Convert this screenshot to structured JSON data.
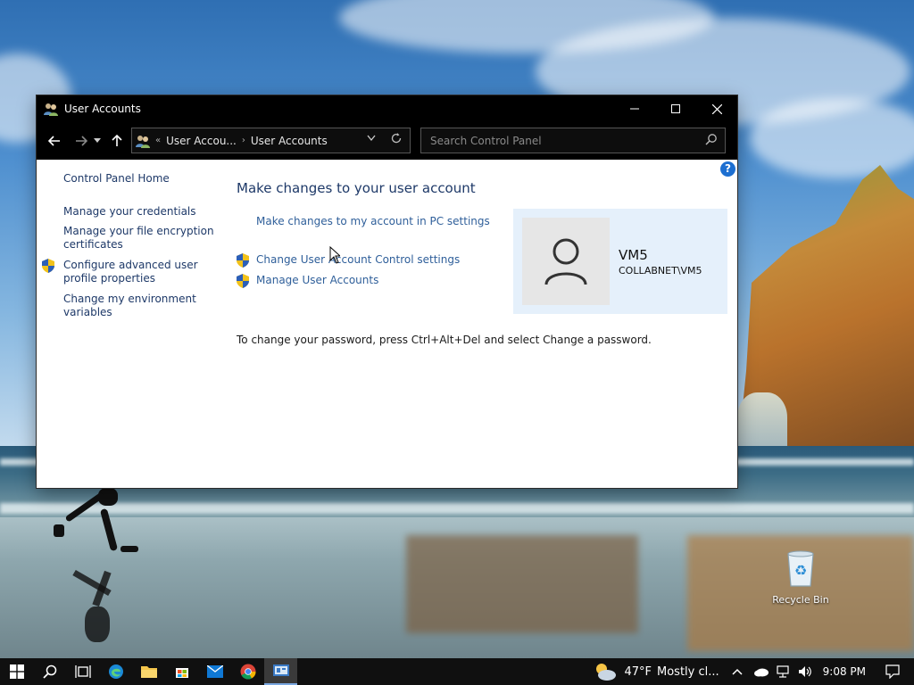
{
  "window": {
    "title": "User Accounts",
    "controls": {
      "minimize": "–",
      "maximize": "☐",
      "close": "✕"
    }
  },
  "navbar": {
    "breadcrumb": [
      "User Accou...",
      "User Accounts"
    ],
    "breadcrumb_prefix": "«",
    "search_placeholder": "Search Control Panel"
  },
  "sidebar": {
    "home": "Control Panel Home",
    "items": [
      "Manage your credentials",
      "Manage your file encryption certificates",
      "Configure advanced user profile properties",
      "Change my environment variables"
    ]
  },
  "main": {
    "title": "Make changes to your user account",
    "links": {
      "pc_settings": "Make changes to my account in PC settings",
      "uac": "Change User Account Control settings",
      "manage": "Manage User Accounts"
    },
    "password_note": "To change your password, press Ctrl+Alt+Del and select Change a password."
  },
  "account": {
    "name": "VM5",
    "domain": "COLLABNET\\VM5"
  },
  "desktop": {
    "recycle_bin": "Recycle Bin"
  },
  "taskbar": {
    "weather_temp": "47°F",
    "weather_text": "Mostly cl...",
    "time": "9:08 PM"
  },
  "colors": {
    "link": "#2f5f9a",
    "heading": "#1e3968",
    "card_bg": "#e5f0fb",
    "chrome": "#000000",
    "taskbar": "#101010"
  }
}
